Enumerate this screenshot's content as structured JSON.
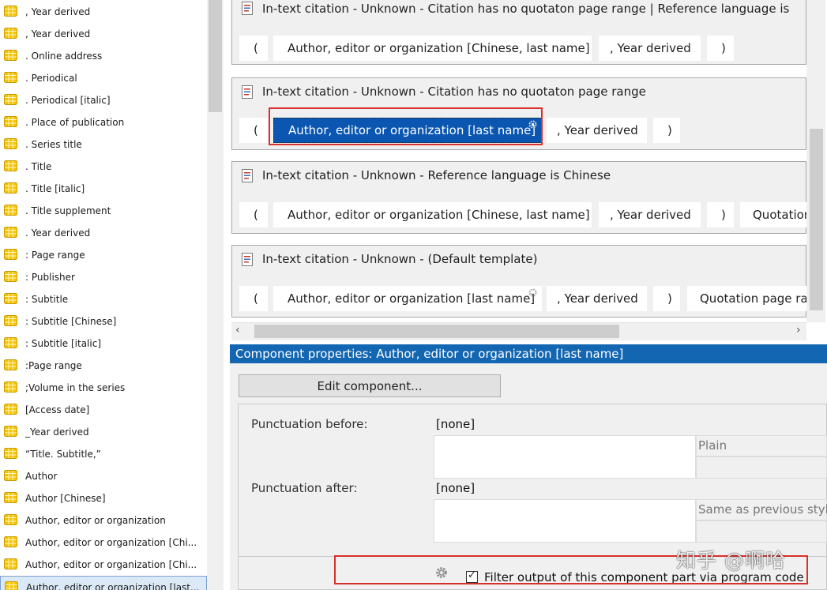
{
  "left_list": {
    "items": [
      {
        "label": ", Year derived"
      },
      {
        "label": ", Year derived"
      },
      {
        "label": ". Online address"
      },
      {
        "label": ". Periodical"
      },
      {
        "label": ". Periodical [italic]"
      },
      {
        "label": ". Place of publication"
      },
      {
        "label": ". Series title"
      },
      {
        "label": ". Title"
      },
      {
        "label": ". Title [italic]"
      },
      {
        "label": ". Title supplement"
      },
      {
        "label": ". Year derived"
      },
      {
        "label": ": Page range"
      },
      {
        "label": ": Publisher"
      },
      {
        "label": ": Subtitle"
      },
      {
        "label": ": Subtitle [Chinese]"
      },
      {
        "label": ": Subtitle [italic]"
      },
      {
        "label": ":Page range"
      },
      {
        "label": ";Volume in the series"
      },
      {
        "label": "[Access date]"
      },
      {
        "label": "_Year derived"
      },
      {
        "label": "“Title. Subtitle,”"
      },
      {
        "label": "Author"
      },
      {
        "label": "Author [Chinese]"
      },
      {
        "label": "Author, editor or organization"
      },
      {
        "label": "Author,  editor  or  organization  [Chi..."
      },
      {
        "label": "Author,  editor  or  organization  [Chi..."
      },
      {
        "label": "Author,  editor  or  organization  [last..."
      }
    ]
  },
  "templates": [
    {
      "title": "In-text citation - Unknown - Citation has no quotaton page range | Reference language is",
      "chips": [
        "(",
        "Author, editor or organization [Chinese, last name]",
        ", Year derived",
        ")"
      ]
    },
    {
      "title": "In-text citation - Unknown - Citation has no quotaton page range",
      "chips": [
        "(",
        "Author, editor or organization [last name]",
        ", Year derived",
        ")"
      ]
    },
    {
      "title": "In-text citation - Unknown - Reference language is Chinese",
      "chips": [
        "(",
        "Author, editor or organization [Chinese, last name]",
        ", Year derived",
        ")",
        "Quotation"
      ]
    },
    {
      "title": "In-text citation - Unknown - (Default template)",
      "chips": [
        "(",
        "Author, editor or organization [last name]",
        ", Year derived",
        ")",
        "Quotation page rar"
      ]
    }
  ],
  "properties": {
    "header": "Component properties:  Author, editor or organization [last name]",
    "edit_button": "Edit component...",
    "punct_before_label": "Punctuation before:",
    "punct_before_value": "[none]",
    "punct_before_style": "Plain",
    "punct_after_label": "Punctuation after:",
    "punct_after_value": "[none]",
    "punct_after_style": "Same as previous style",
    "filter_label": "Filter output of this component part via program code",
    "filter_checked": "✓"
  },
  "watermark": "知乎 @啊哈",
  "colors": {
    "selection": "#0a56b0",
    "highlight": "#d9302c",
    "prop_header": "#1366b1"
  }
}
